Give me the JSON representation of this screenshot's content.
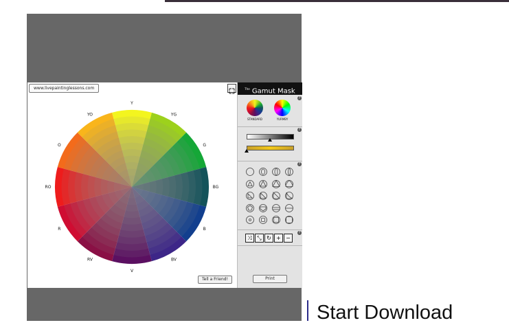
{
  "page": {
    "background": "#ffffff",
    "panel_color": "#676767"
  },
  "app": {
    "url_button": "www.livepaintinglessons.com",
    "tell_button": "Tell a Friend!",
    "wheel": {
      "labels": [
        "Y",
        "YG",
        "G",
        "BG",
        "B",
        "BV",
        "V",
        "RV",
        "R",
        "RO",
        "O",
        "YO"
      ],
      "colors": [
        "#f3f51f",
        "#9dd11c",
        "#15a737",
        "#14535a",
        "#123f8e",
        "#3d2688",
        "#5b1061",
        "#8a1045",
        "#cf0d32",
        "#ee1c1c",
        "#f36b1b",
        "#f9b51b"
      ]
    }
  },
  "sidebar": {
    "title_prefix": "The",
    "title": "Gamut Mask",
    "help_mark": "?",
    "modes": [
      {
        "label": "STANDARD"
      },
      {
        "label": "YURMBY"
      }
    ],
    "shapes": [
      [
        "circle-icon",
        "oval-icon",
        "narrow-oval-icon",
        "slim-oval-icon"
      ],
      [
        "triangle-small-icon",
        "triangle-medium-icon",
        "triangle-large-icon",
        "triangle-rounded-icon"
      ],
      [
        "right-triangle-small-icon",
        "right-triangle-medium-icon",
        "right-triangle-large-icon",
        "right-triangle-rounded-icon"
      ],
      [
        "pentagon-icon",
        "house-icon",
        "segment-icon",
        "half-circle-icon"
      ],
      [
        "small-circle-icon",
        "rounded-square-icon",
        "square-icon",
        "large-square-icon"
      ]
    ],
    "tools": [
      "swap-icon",
      "shrink-icon",
      "rotate-icon",
      "plus-icon",
      "minus-icon"
    ],
    "tool_glyphs": [
      "⤨",
      "⤡",
      "↻",
      "+",
      "−"
    ],
    "print_button": "Print"
  },
  "download": {
    "label": "Start Download",
    "accent": "#2b2b8a"
  }
}
